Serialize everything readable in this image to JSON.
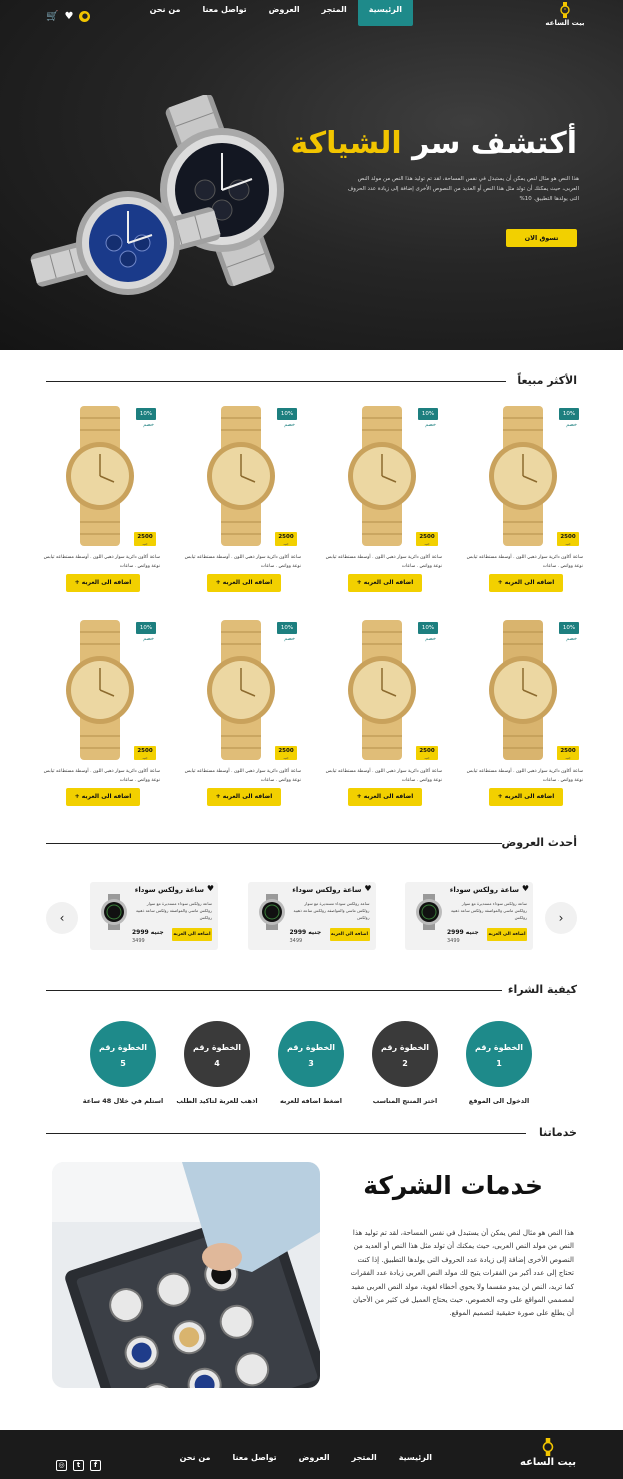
{
  "brand": {
    "name": "بيت الساعه"
  },
  "nav": {
    "items": [
      "الرئيسية",
      "المتجر",
      "العروض",
      "تواصل معنا",
      "من نحن"
    ],
    "active_index": 0
  },
  "hero": {
    "title_part1": "أكتشف سر",
    "title_part2": "الشياكة",
    "text": "هذا النص هو مثال لنص يمكن أن يستبدل في نفس المساحة، لقد تم توليد هذا النص من مولد النص العربى، حيث يمكنك أن تولد مثل هذا النص أو العديد من النصوص الأخرى إضافة إلى زيادة عدد الحروف التى يولدها التطبيق. 10%",
    "button": "تسوق الان"
  },
  "best_sellers": {
    "heading": "الأكثر مبيعاً",
    "badge": "10%",
    "badge_label": "خصم",
    "price": "2500",
    "price_unit": "جنيه",
    "desc": "ساعة أكاون دائرية سوار ذهبي اللون . أوسطة مستطاعه ثيابس نوعة وواتص . ساعات",
    "button": "+ اضافه الى العربه",
    "count": 8
  },
  "offers": {
    "heading": "أحدث العروض",
    "items": [
      {
        "title": "ساعة رولكس سوداء",
        "desc": "ساعة رولكس سوداء مستديرة مع سوار رولكس ماسي والمواصفة رولكس ساعة ذهبية رولكس",
        "button": "اضافه الى العربه",
        "price": "2999 جنيه",
        "old_price": "3499"
      },
      {
        "title": "ساعة رولكس سوداء",
        "desc": "ساعة رولكس سوداء مستديرة مع سوار رولكس ماسي والمواصفة رولكس ساعة ذهبية رولكس",
        "button": "اضافه الى العربه",
        "price": "2999 جنيه",
        "old_price": "3499"
      },
      {
        "title": "ساعة رولكس سوداء",
        "desc": "ساعة رولكس سوداء مستديرة مع سوار رولكس ماسي والمواصفة رولكس ساعة ذهبية رولكس",
        "button": "اضافه الى العربه",
        "price": "2999 جنيه",
        "old_price": "3499"
      }
    ]
  },
  "how_to_buy": {
    "heading": "كيفية الشراء",
    "steps": [
      {
        "label": "الخطوة رقم",
        "num": "1",
        "caption": "الدخول الى الموقع",
        "color": "teal"
      },
      {
        "label": "الخطوة رقم",
        "num": "2",
        "caption": "اختر المنتج المناسب",
        "color": "dark"
      },
      {
        "label": "الخطوة رقم",
        "num": "3",
        "caption": "اضغط اضافه للعربه",
        "color": "teal"
      },
      {
        "label": "الخطوة رقم",
        "num": "4",
        "caption": "اذهب للعربة لتاكيد الطلب",
        "color": "dark"
      },
      {
        "label": "الخطوة رقم",
        "num": "5",
        "caption": "استلم في خلال 48 ساعة",
        "color": "teal"
      }
    ]
  },
  "services": {
    "heading": "خدماتنا",
    "title": "خدمات الشركة",
    "text": "هذا النص هو مثال لنص يمكن أن يستبدل في نفس المساحة، لقد تم توليد هذا النص من مولد النص العربى، حيث يمكنك أن تولد مثل هذا النص أو العديد من النصوص الأخرى إضافة إلى زيادة عدد الحروف التى يولدها التطبيق. إذا كنت تحتاج إلى عدد أكبر من الفقرات يتيح لك مولد النص العربى زيادة عدد الفقرات كما تريد، النص لن يبدو مقسما ولا يحوي أخطاء لغوية، مولد النص العربى مفيد لمصممي المواقع على وجه الخصوص، حيث يحتاج العميل فى كثير من الأحيان أن يطلع على صورة حقيقية لتصميم الموقع."
  },
  "footer": {
    "brand": "بيت الساعه",
    "items": [
      "الرئيسية",
      "المتجر",
      "العروض",
      "تواصل معنا",
      "من نحن"
    ],
    "social": [
      "facebook-icon",
      "twitter-icon",
      "instagram-icon"
    ]
  },
  "colors": {
    "accent": "#f2d000",
    "teal": "#1e8a8a",
    "dark": "#1b1b1b"
  }
}
